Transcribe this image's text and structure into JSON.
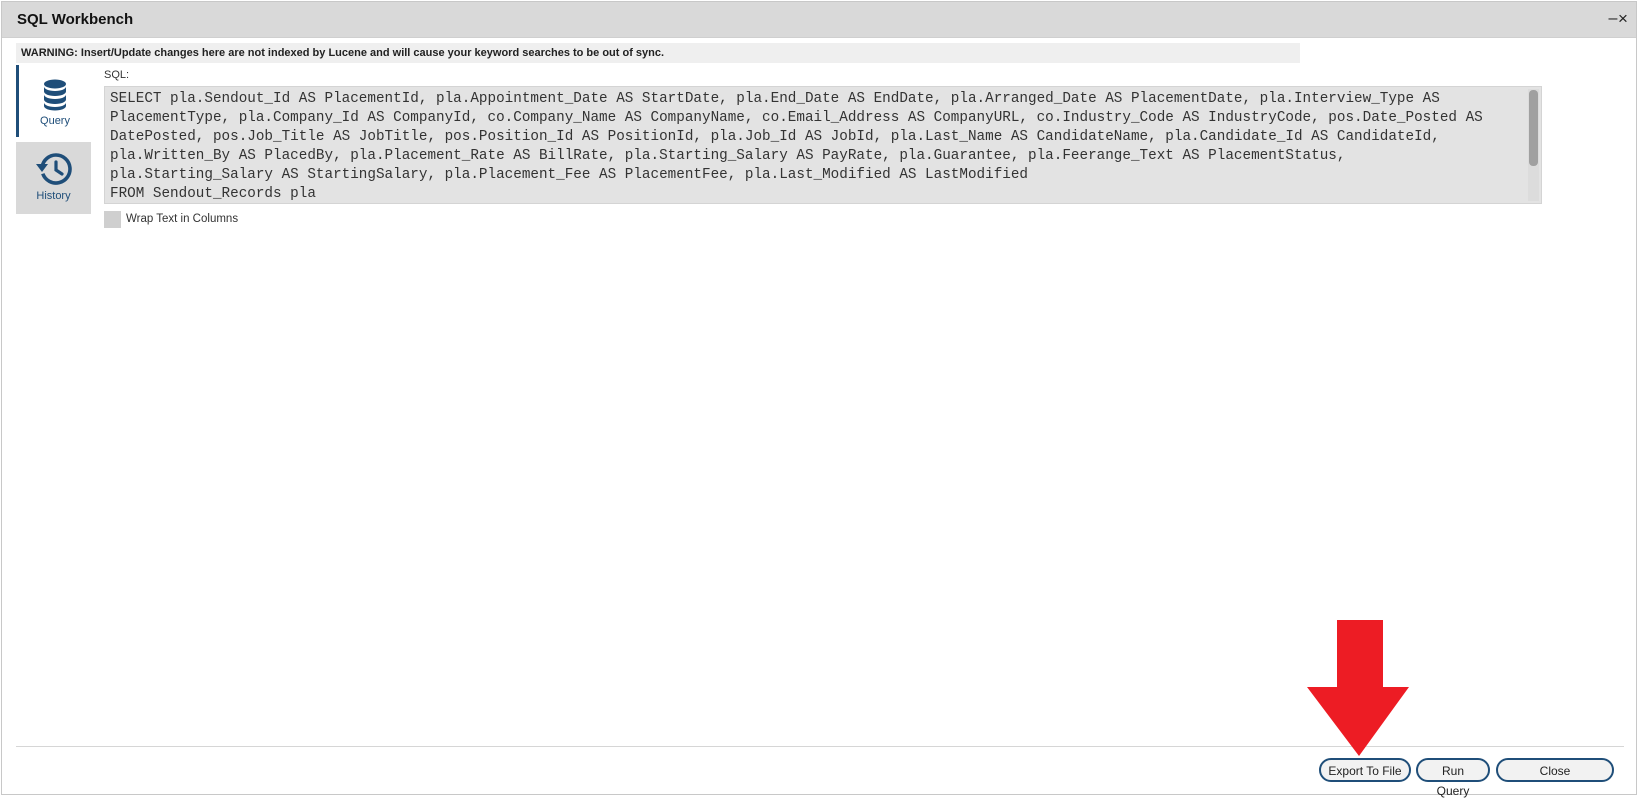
{
  "window": {
    "title": "SQL Workbench",
    "minimize_label": "–",
    "close_label": "×"
  },
  "warning": "WARNING: Insert/Update changes here are not indexed by Lucene and will cause your keyword searches to be out of sync.",
  "sidebar": {
    "tabs": [
      {
        "label": "Query",
        "icon": "database-icon",
        "active": true
      },
      {
        "label": "History",
        "icon": "history-icon",
        "active": false
      }
    ]
  },
  "sql": {
    "label": "SQL:",
    "value": "SELECT pla.Sendout_Id AS PlacementId, pla.Appointment_Date AS StartDate, pla.End_Date AS EndDate, pla.Arranged_Date AS PlacementDate, pla.Interview_Type AS PlacementType, pla.Company_Id AS CompanyId, co.Company_Name AS CompanyName, co.Email_Address AS CompanyURL, co.Industry_Code AS IndustryCode, pos.Date_Posted AS DatePosted, pos.Job_Title AS JobTitle, pos.Position_Id AS PositionId, pla.Job_Id AS JobId, pla.Last_Name AS CandidateName, pla.Candidate_Id AS CandidateId, pla.Written_By AS PlacedBy, pla.Placement_Rate AS BillRate, pla.Starting_Salary AS PayRate, pla.Guarantee, pla.Feerange_Text AS PlacementStatus, pla.Starting_Salary AS StartingSalary, pla.Placement_Fee AS PlacementFee, pla.Last_Modified AS LastModified\nFROM Sendout_Records pla\nLEFT JOIN positions pos ON pos.Job_Id = pla.Job_Id"
  },
  "options": {
    "wrap_text_label": "Wrap Text in Columns",
    "wrap_text_checked": false
  },
  "buttons": {
    "export": "Export To File",
    "run": "Run Query",
    "close": "Close"
  },
  "colors": {
    "accent": "#1f4e79",
    "annotation_arrow": "#ed1c24"
  }
}
